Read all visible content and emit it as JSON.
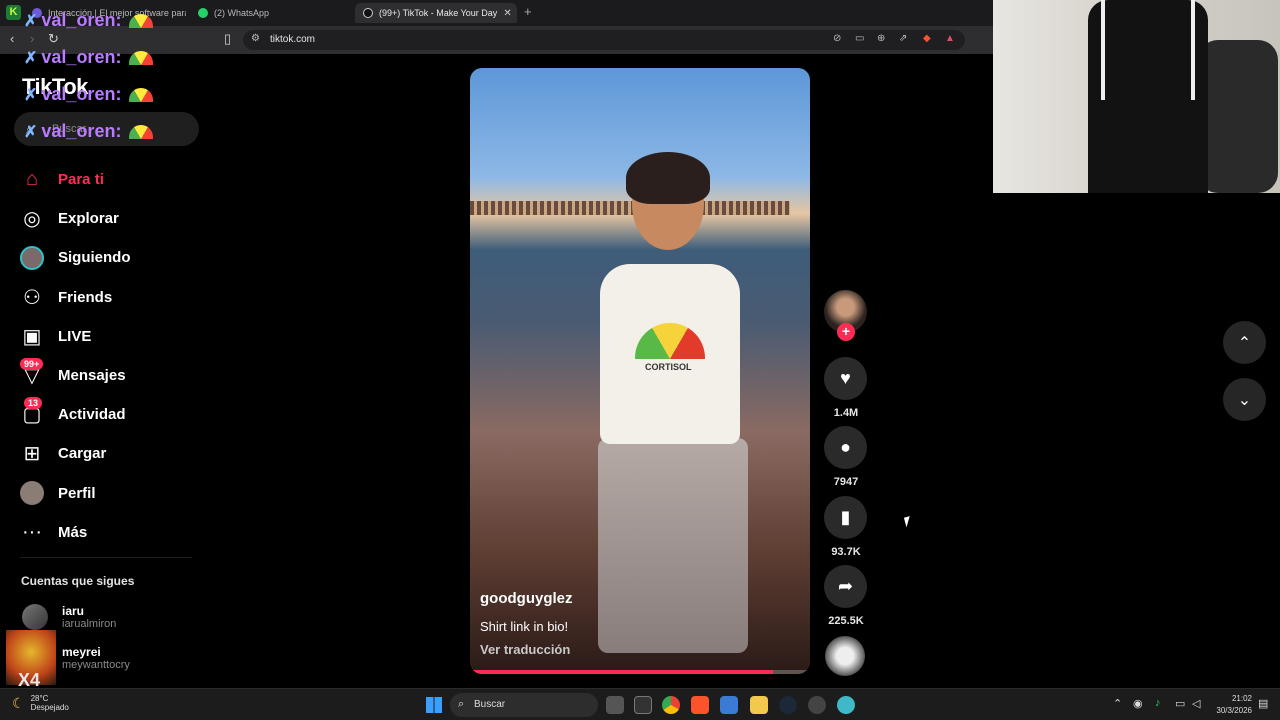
{
  "browser": {
    "tabs": [
      {
        "label": "Interacción | El mejor software para p",
        "active": false
      },
      {
        "label": "(2) WhatsApp",
        "active": false
      },
      {
        "label": "(99+) TikTok - Make Your Day",
        "active": true
      }
    ],
    "url": "tiktok.com"
  },
  "chat_overlay": {
    "lines": [
      "val_oren:",
      "val_oren:",
      "val_oren:",
      "val_oren:"
    ]
  },
  "sidebar": {
    "logo": "TikTok",
    "search_placeholder": "Buscar",
    "items": [
      {
        "label": "Para ti",
        "icon": "home-icon",
        "active": true
      },
      {
        "label": "Explorar",
        "icon": "compass-icon"
      },
      {
        "label": "Siguiendo",
        "icon": "following-avatar-icon"
      },
      {
        "label": "Friends",
        "icon": "friends-icon"
      },
      {
        "label": "LIVE",
        "icon": "live-tv-icon"
      },
      {
        "label": "Mensajes",
        "icon": "messages-icon",
        "badge": "99+"
      },
      {
        "label": "Actividad",
        "icon": "activity-icon",
        "badge": "13"
      },
      {
        "label": "Cargar",
        "icon": "upload-icon"
      },
      {
        "label": "Perfil",
        "icon": "profile-avatar-icon"
      },
      {
        "label": "Más",
        "icon": "more-icon"
      }
    ],
    "following_title": "Cuentas que sigues",
    "following": [
      {
        "name": "iaru",
        "handle": "iarualmiron"
      },
      {
        "name": "meyrei",
        "handle": "meywanttocry"
      }
    ],
    "stream_badge": "X4"
  },
  "video": {
    "username": "goodguyglez",
    "description": "Shirt link in bio!",
    "translate": "Ver traducción",
    "shirt_text": "CORTISOL",
    "progress": 0.89
  },
  "actions": {
    "likes": "1.4M",
    "comments": "7947",
    "saves": "93.7K",
    "shares": "225.5K"
  },
  "taskbar": {
    "temperature": "28°C",
    "weather": "Despejado",
    "search": "Buscar",
    "time": "21:02",
    "date": "30/3/2026"
  },
  "colors": {
    "accent": "#fe2c55",
    "background": "#000000"
  }
}
